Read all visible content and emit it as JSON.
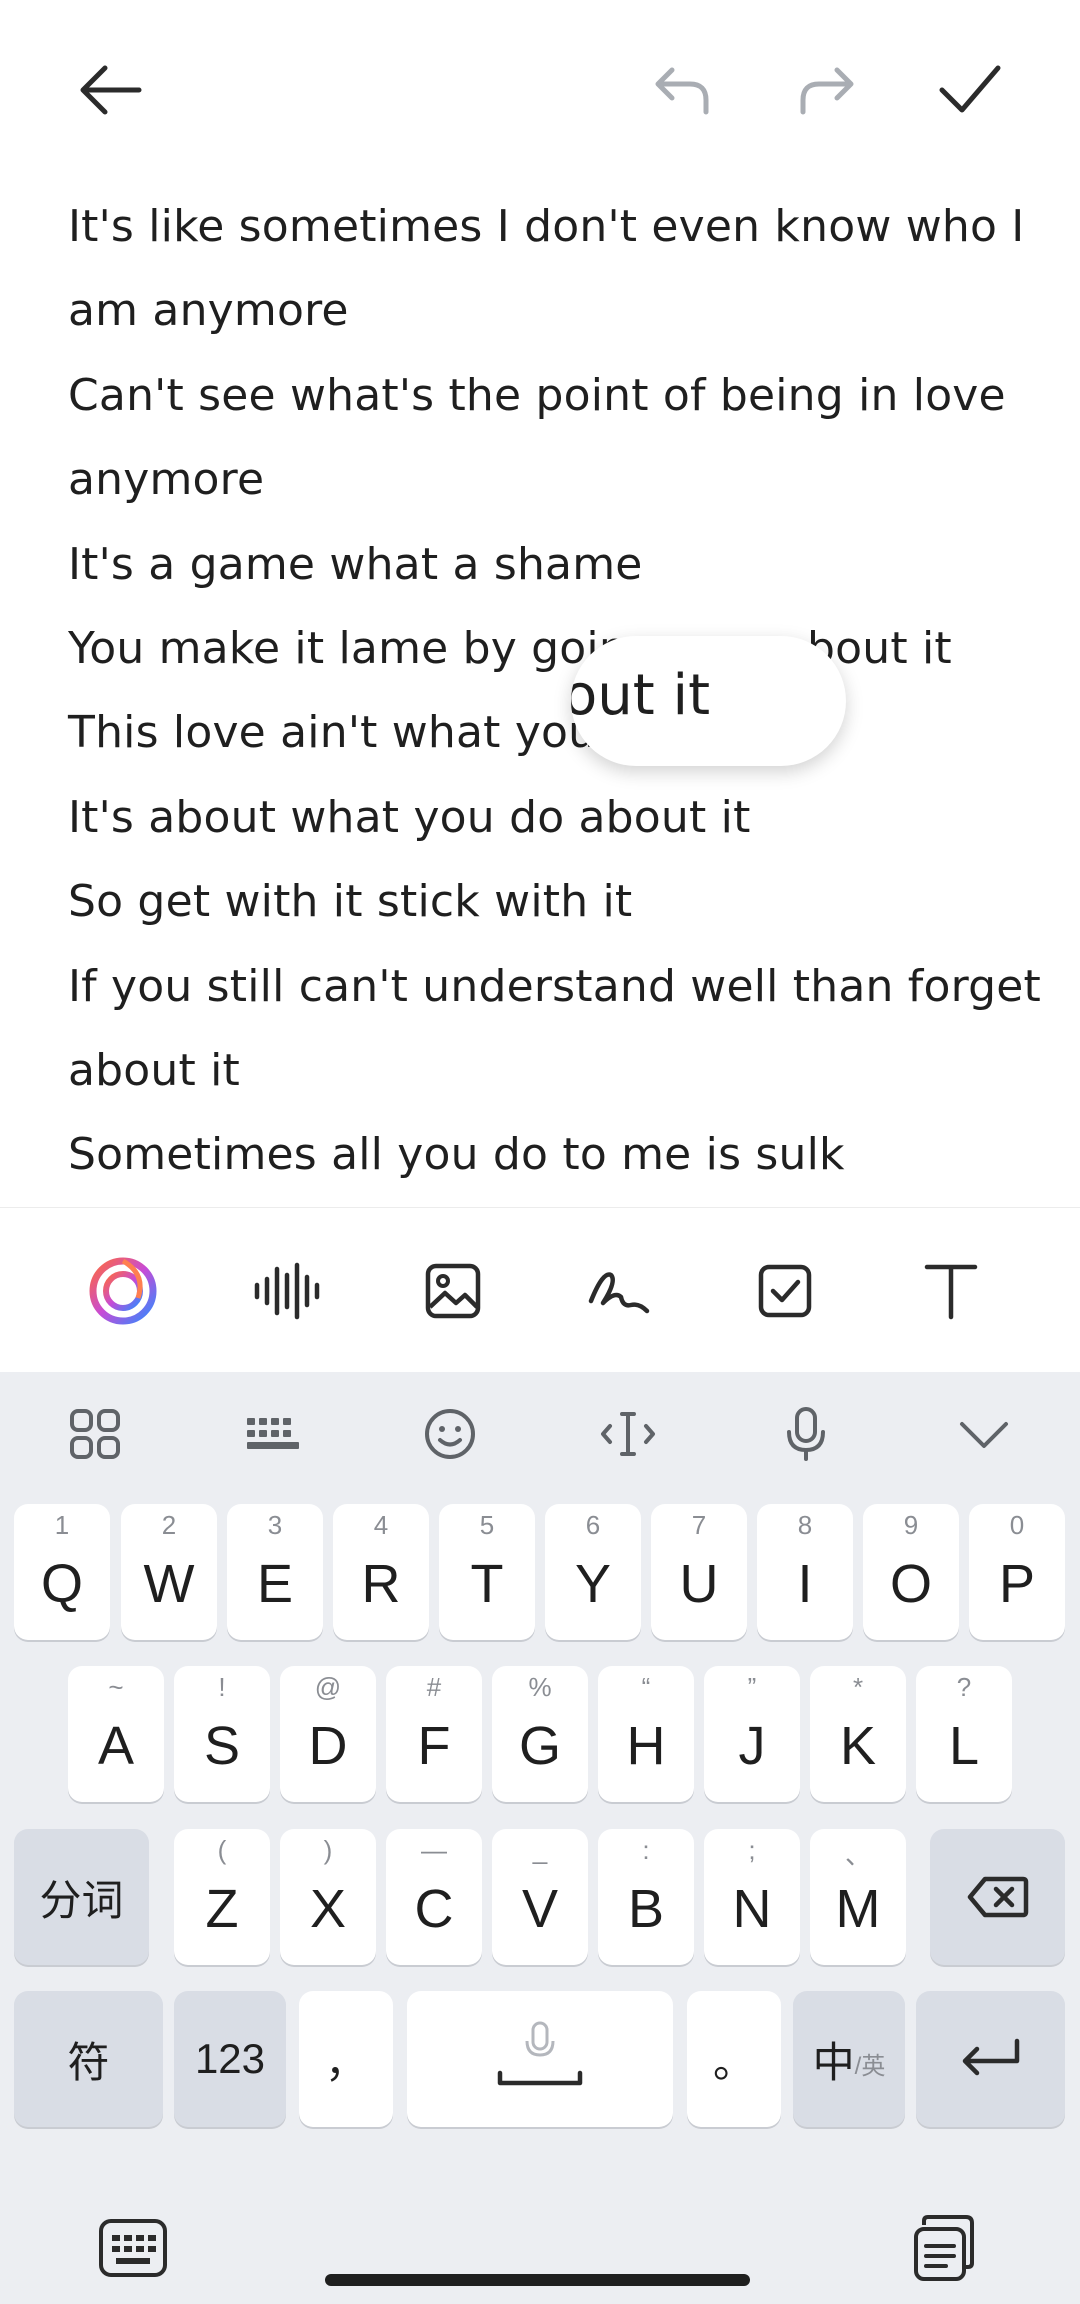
{
  "editor": {
    "lines": [
      "It's like sometimes I don't even know who I",
      "am anymore",
      "Can't see what's the point of being in love",
      "anymore",
      "It's a game what a shame",
      "You make it lame by goin",
      "This love ain't what you",
      "It's about what you do about it",
      "So get with it stick with it",
      "If you still can't understand well than forget",
      "about it",
      "Sometimes all you do to me is sulk"
    ],
    "line6_tail": "bout it",
    "magnifier_text": "out it"
  },
  "toolbar": {
    "items": [
      "ai-icon",
      "audio-icon",
      "image-icon",
      "handwriting-icon",
      "checklist-icon",
      "text-format-icon"
    ]
  },
  "keyboard": {
    "row1": [
      {
        "k": "Q",
        "h": "1"
      },
      {
        "k": "W",
        "h": "2"
      },
      {
        "k": "E",
        "h": "3"
      },
      {
        "k": "R",
        "h": "4"
      },
      {
        "k": "T",
        "h": "5"
      },
      {
        "k": "Y",
        "h": "6"
      },
      {
        "k": "U",
        "h": "7"
      },
      {
        "k": "I",
        "h": "8"
      },
      {
        "k": "O",
        "h": "9"
      },
      {
        "k": "P",
        "h": "0"
      }
    ],
    "row2": [
      {
        "k": "A",
        "h": "~"
      },
      {
        "k": "S",
        "h": "!"
      },
      {
        "k": "D",
        "h": "@"
      },
      {
        "k": "F",
        "h": "#"
      },
      {
        "k": "G",
        "h": "%"
      },
      {
        "k": "H",
        "h": "“"
      },
      {
        "k": "J",
        "h": "”"
      },
      {
        "k": "K",
        "h": "*"
      },
      {
        "k": "L",
        "h": "?"
      }
    ],
    "row3": [
      {
        "k": "Z",
        "h": "("
      },
      {
        "k": "X",
        "h": ")"
      },
      {
        "k": "C",
        "h": "—"
      },
      {
        "k": "V",
        "h": "_"
      },
      {
        "k": "B",
        "h": ":"
      },
      {
        "k": "N",
        "h": ";"
      },
      {
        "k": "M",
        "h": "、"
      }
    ],
    "segment_label": "分词",
    "symbols_label": "符",
    "numbers_label": "123",
    "comma_label": "，",
    "period_label": "。",
    "lang_main": "中",
    "lang_sub": "/英"
  }
}
